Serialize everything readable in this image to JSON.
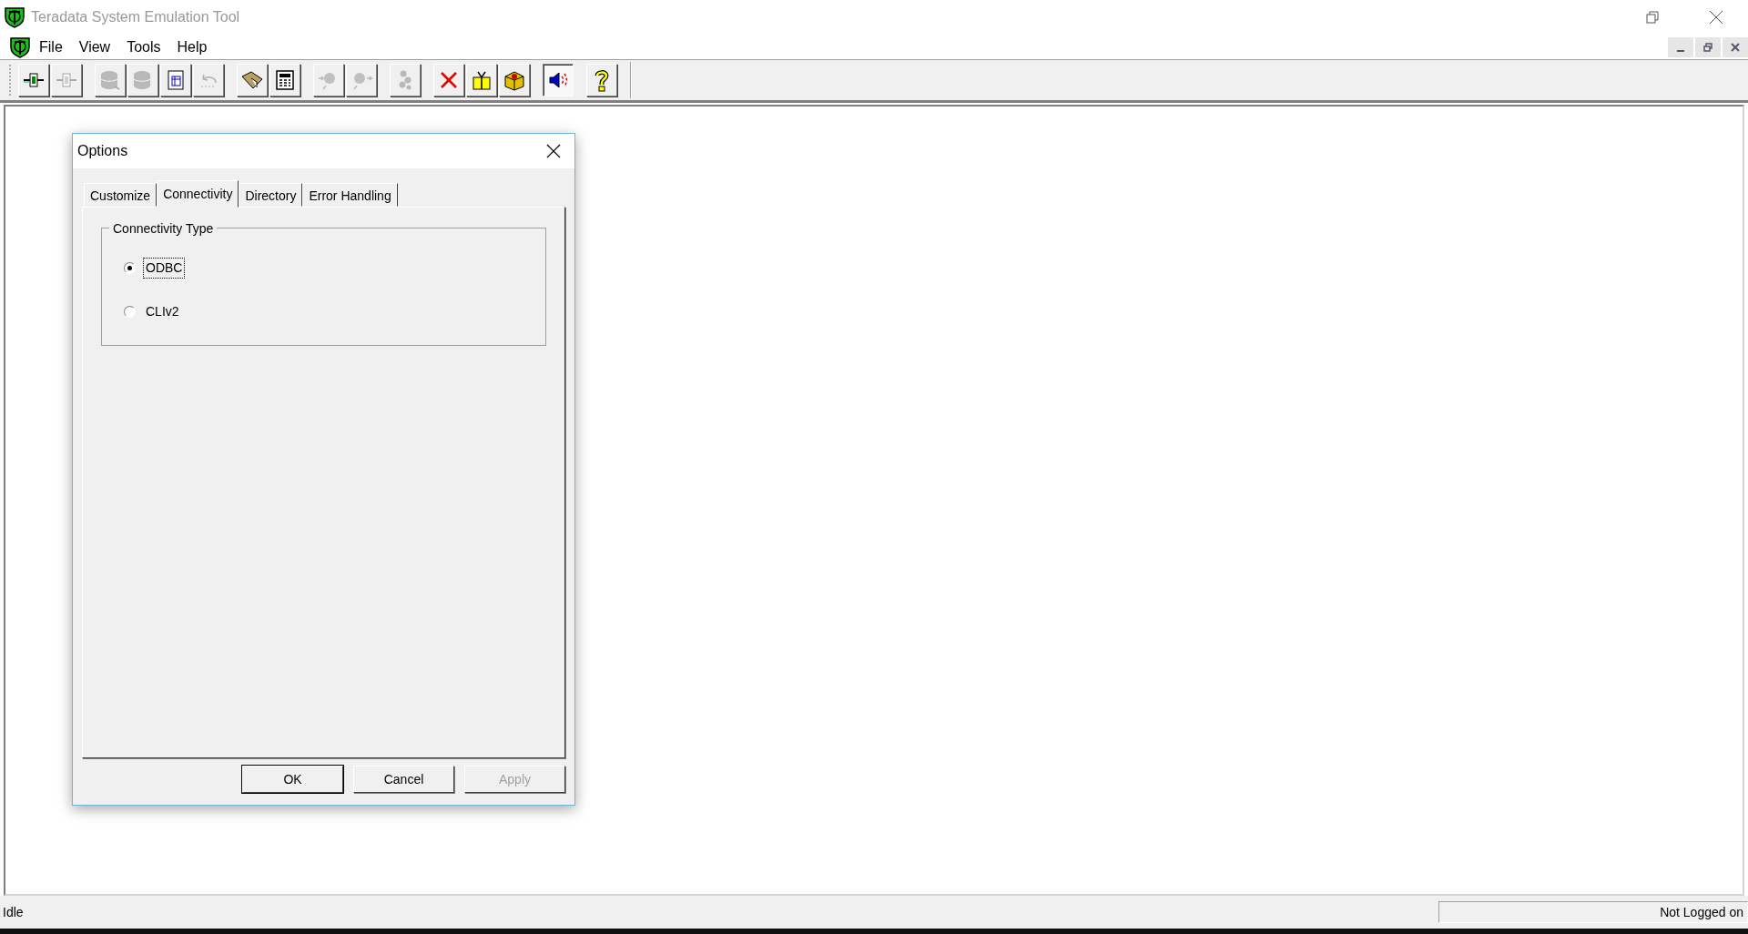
{
  "window": {
    "title": "Teradata System Emulation Tool"
  },
  "menu": [
    {
      "label": "File"
    },
    {
      "label": "View"
    },
    {
      "label": "Tools"
    },
    {
      "label": "Help"
    }
  ],
  "toolbar": [
    [
      {
        "disabled": false,
        "pressed": false
      },
      {
        "disabled": true,
        "pressed": false
      }
    ],
    [
      {
        "disabled": true,
        "pressed": false
      },
      {
        "disabled": true,
        "pressed": false
      },
      {
        "disabled": false,
        "pressed": false
      },
      {
        "disabled": true,
        "pressed": false
      }
    ],
    [
      {
        "disabled": false,
        "pressed": false
      },
      {
        "disabled": false,
        "pressed": false
      }
    ],
    [
      {
        "disabled": true,
        "pressed": false
      },
      {
        "disabled": true,
        "pressed": false
      }
    ],
    [
      {
        "disabled": true,
        "pressed": false
      }
    ],
    [
      {
        "disabled": false,
        "pressed": false
      },
      {
        "disabled": false,
        "pressed": false
      },
      {
        "disabled": false,
        "pressed": false
      }
    ],
    [
      {
        "disabled": false,
        "pressed": true
      }
    ],
    [
      {
        "disabled": false,
        "pressed": false
      }
    ]
  ],
  "dialog": {
    "title": "Options",
    "tabs": [
      {
        "label": "Customize",
        "selected": false
      },
      {
        "label": "Connectivity",
        "selected": true
      },
      {
        "label": "Directory",
        "selected": false
      },
      {
        "label": "Error Handling",
        "selected": false
      }
    ],
    "group": {
      "title": "Connectivity Type",
      "options": [
        {
          "label": "ODBC",
          "selected": true,
          "focused": true
        },
        {
          "label": "CLIv2",
          "selected": false,
          "focused": false
        }
      ]
    },
    "buttons": [
      {
        "label": "OK",
        "default": true,
        "disabled": false
      },
      {
        "label": "Cancel",
        "default": false,
        "disabled": false
      },
      {
        "label": "Apply",
        "default": false,
        "disabled": true
      }
    ]
  },
  "status_bar": {
    "left": "Idle",
    "right": "Not Logged on"
  }
}
